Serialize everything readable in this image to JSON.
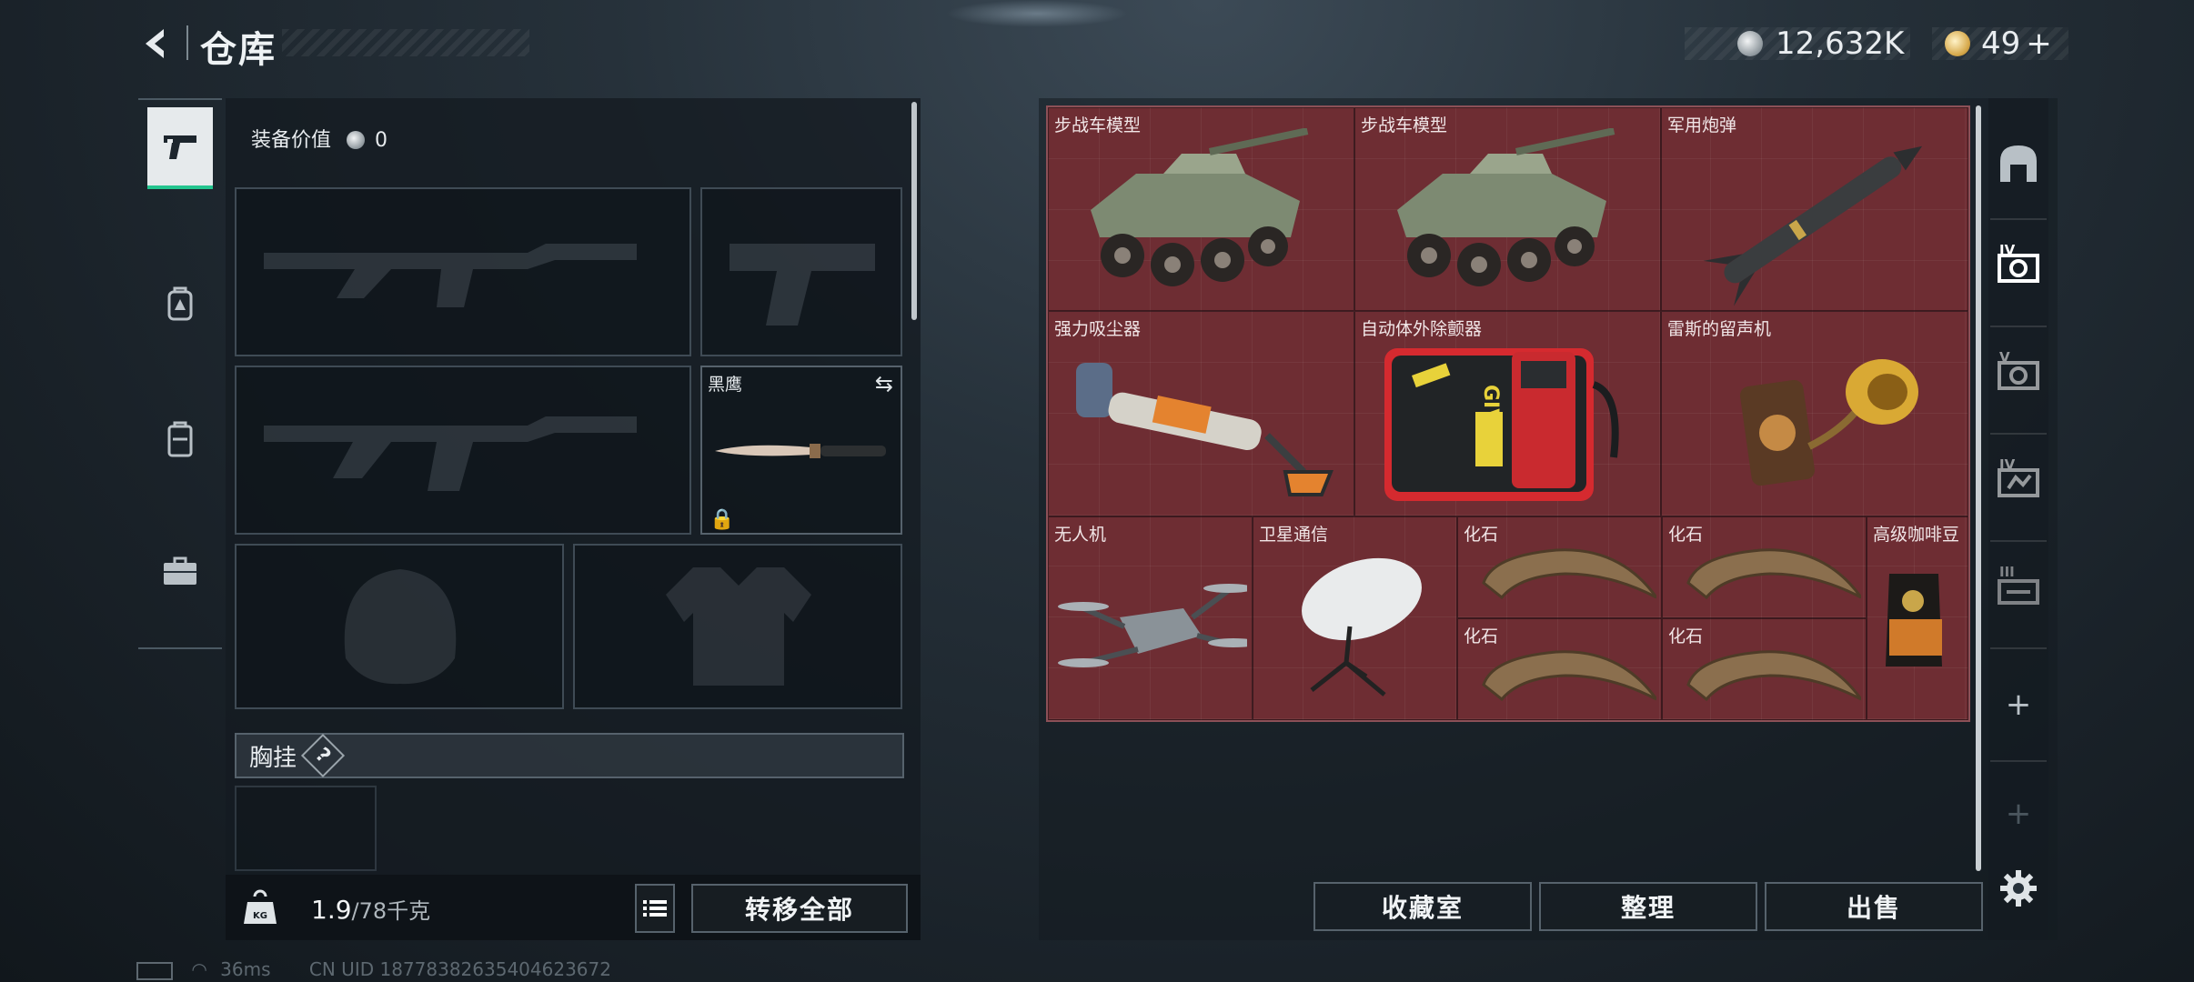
{
  "header": {
    "title": "仓库",
    "silver_amount": "12,632K",
    "gold_amount": "49",
    "gold_plus": "+"
  },
  "loadout": {
    "equipment_value_label": "装备价值",
    "equipment_value": "0",
    "melee_name": "黑鹰",
    "chest_rig_label": "胸挂",
    "chest_rig_help": "?",
    "weight_current": "1.9",
    "weight_max": "/78千克",
    "transfer_all": "转移全部"
  },
  "inventory": {
    "items": [
      {
        "name": "步战车模型"
      },
      {
        "name": "步战车模型"
      },
      {
        "name": "军用炮弹"
      },
      {
        "name": "强力吸尘器"
      },
      {
        "name": "自动体外除颤器"
      },
      {
        "name": "雷斯的留声机"
      },
      {
        "name": "无人机"
      },
      {
        "name": "卫星通信"
      },
      {
        "name": "化石"
      },
      {
        "name": "化石"
      },
      {
        "name": "高级咖啡豆"
      },
      {
        "name": "化石"
      },
      {
        "name": "化石"
      }
    ],
    "defib_tag": "GIV"
  },
  "side_tabs": {
    "tab_iv": "IV",
    "tab_v": "V",
    "tab_iv2": "IV",
    "tab_iii": "III",
    "add1": "+",
    "add2": "+"
  },
  "actions": {
    "collection": "收藏室",
    "sort": "整理",
    "sell": "出售"
  },
  "status": {
    "ping": "36ms",
    "uid": "CN UID 18778382635404623672"
  },
  "colors": {
    "grid_bg": "#6e2d33",
    "active_tab_accent": "#23c48e",
    "panel_bg": "#141b21"
  }
}
